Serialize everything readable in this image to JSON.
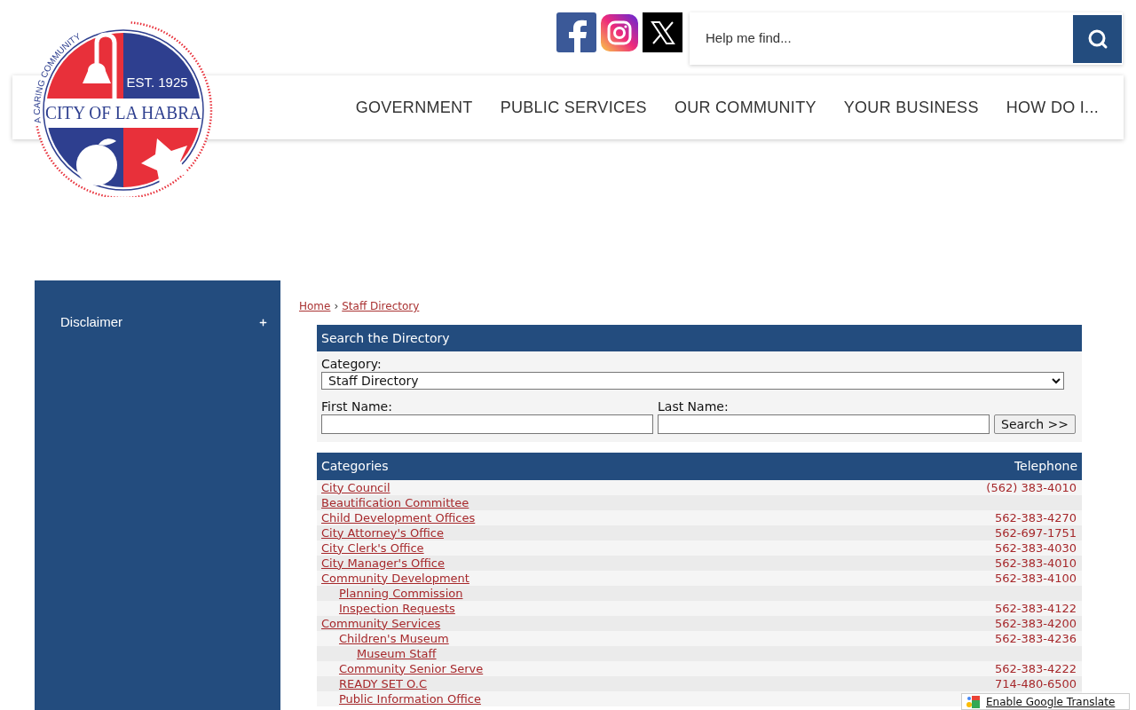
{
  "header": {
    "logo": {
      "motto": "A CARING COMMUNITY",
      "established": "EST. 1925",
      "name": "CITY OF LA HABRA"
    },
    "social_links": [
      {
        "kind": "facebook"
      },
      {
        "kind": "instagram"
      },
      {
        "kind": "x"
      }
    ],
    "search": {
      "placeholder": "Help me find..."
    },
    "nav": [
      "GOVERNMENT",
      "PUBLIC SERVICES",
      "OUR COMMUNITY",
      "YOUR BUSINESS",
      "HOW DO I..."
    ]
  },
  "sidebar": {
    "items": [
      {
        "label": "Disclaimer",
        "expanded": false
      }
    ]
  },
  "breadcrumb": {
    "separator": "›",
    "items": [
      "Home",
      "Staff Directory"
    ]
  },
  "directory_search": {
    "title": "Search the Directory",
    "category_label": "Category:",
    "category_value": "Staff Directory",
    "first_name_label": "First Name:",
    "last_name_label": "Last Name:",
    "button": "Search >>"
  },
  "table": {
    "columns": [
      "Categories",
      "Telephone"
    ],
    "rows": [
      {
        "name": "City Council",
        "phone": "(562) 383-4010"
      },
      {
        "name": "Beautification Committee"
      },
      {
        "name": "Child Development Offices",
        "phone": "562-383-4270"
      },
      {
        "name": "City Attorney's Office",
        "phone": "562-697-1751"
      },
      {
        "name": "City Clerk's Office",
        "phone": "562-383-4030"
      },
      {
        "name": "City Manager's Office",
        "phone": "562-383-4010"
      },
      {
        "name": "Community Development",
        "phone": "562-383-4100",
        "children": [
          {
            "name": "Planning Commission"
          },
          {
            "name": "Inspection Requests",
            "phone": "562-383-4122"
          }
        ]
      },
      {
        "name": "Community Services",
        "phone": "562-383-4200",
        "children": [
          {
            "name": "Children's Museum",
            "phone": "562-383-4236",
            "children": [
              {
                "name": "Museum Staff"
              }
            ]
          },
          {
            "name": "Community Senior Serve",
            "phone": "562-383-4222"
          },
          {
            "name": "READY SET O.C",
            "phone": "714-480-6500"
          },
          {
            "name": "Public Information Office"
          }
        ]
      }
    ]
  },
  "translate_button": "Enable Google Translate"
}
